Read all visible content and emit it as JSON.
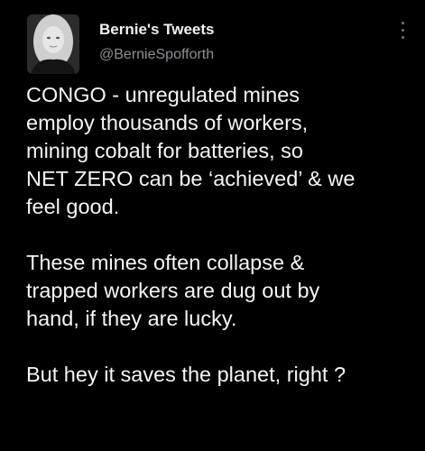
{
  "tweet": {
    "author": {
      "display_name": "Bernie's Tweets",
      "handle": "@BernieSpofforth"
    },
    "paragraphs": [
      "CONGO - unregulated mines\nemploy thousands of workers,\nmining cobalt for batteries, so\nNET ZERO can be ‘achieved’ & we\nfeel good.",
      "These mines often collapse &\ntrapped workers are dug out by\nhand, if they are lucky.",
      "But hey it saves the planet, right ?"
    ]
  },
  "icons": {
    "more": "more-options-vertical-icon"
  },
  "colors": {
    "background": "#000000",
    "text": "#f5f5f5",
    "secondary_text": "#8b9196"
  }
}
